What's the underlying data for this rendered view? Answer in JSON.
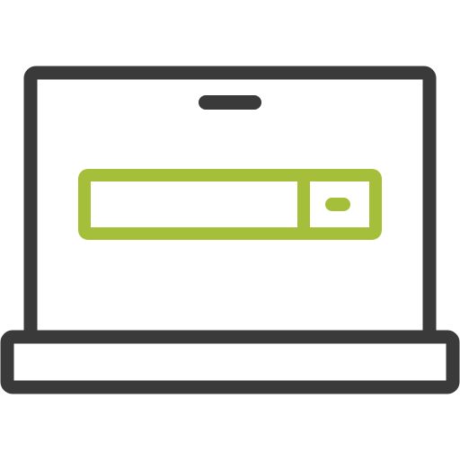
{
  "icon": {
    "name": "laptop-search-icon",
    "parts": [
      "laptop-screen-icon",
      "webcam-icon",
      "laptop-base-icon",
      "search-bar-icon",
      "search-button-icon"
    ]
  },
  "colors": {
    "outline": "#3a3a3a",
    "accent": "#a6bf3a",
    "fill": "#ffffff"
  }
}
